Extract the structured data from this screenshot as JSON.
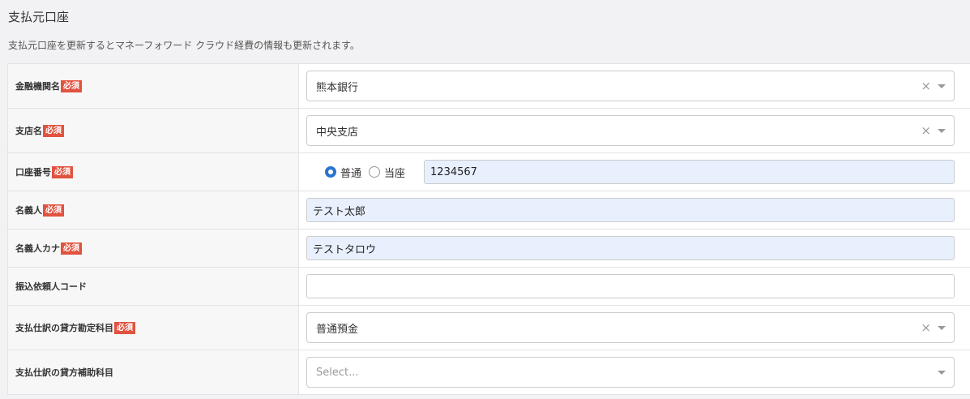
{
  "section": {
    "title": "支払元口座",
    "description": "支払元口座を更新するとマネーフォワード クラウド経費の情報も更新されます。"
  },
  "required_badge": "必須",
  "icons": {
    "clear": "clear-x-icon",
    "dropdown": "dropdown-arrow-icon",
    "radio_checked": "radio-checked-icon",
    "radio_unchecked": "radio-unchecked-icon"
  },
  "colors": {
    "required_badge": "#e0533f",
    "autofill_bg": "#e8f0fe",
    "radio_accent": "#2b73d0"
  },
  "fields": {
    "bank_name": {
      "label": "金融機関名",
      "value": "熊本銀行"
    },
    "branch_name": {
      "label": "支店名",
      "value": "中央支店"
    },
    "account_number": {
      "label": "口座番号",
      "type_options": [
        "普通",
        "当座"
      ],
      "selected_type": "普通",
      "value": "1234567"
    },
    "holder_name": {
      "label": "名義人",
      "value": "テスト太郎"
    },
    "holder_kana": {
      "label": "名義人カナ",
      "value": "テストタロウ"
    },
    "requester_code": {
      "label": "振込依頼人コード",
      "value": ""
    },
    "credit_account": {
      "label": "支払仕訳の貸方勘定科目",
      "value": "普通預金"
    },
    "credit_sub_account": {
      "label": "支払仕訳の貸方補助科目",
      "placeholder": "Select..."
    }
  }
}
